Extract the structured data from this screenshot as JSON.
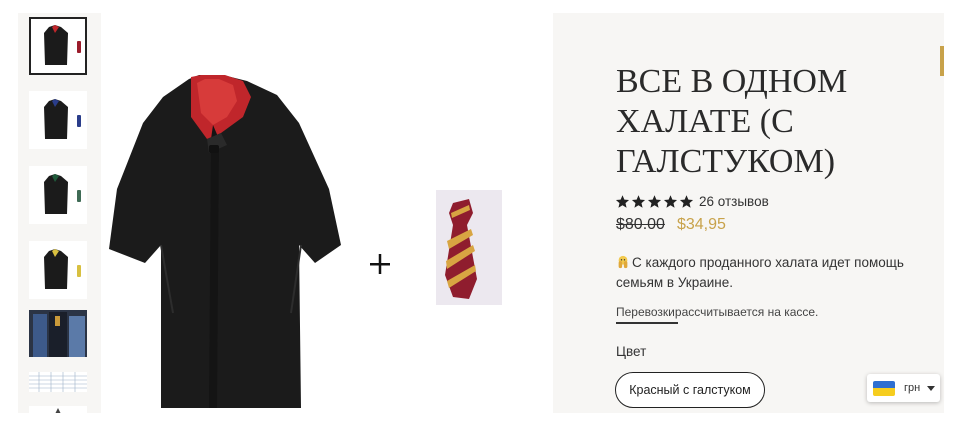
{
  "gallery": {
    "thumbnails": [
      {
        "name": "thumb-robe-red",
        "tie_color": "#9b1c2b",
        "active": true
      },
      {
        "name": "thumb-robe-blue",
        "tie_color": "#2a3d8a",
        "active": false
      },
      {
        "name": "thumb-robe-green",
        "tie_color": "#1f5a3a",
        "active": false
      },
      {
        "name": "thumb-robe-yellow",
        "tie_color": "#d8c040",
        "active": false
      },
      {
        "name": "thumb-robe-photo",
        "active": false
      },
      {
        "name": "thumb-size-chart",
        "active": false
      },
      {
        "name": "thumb-robe-model",
        "active": false
      }
    ],
    "plus_sign": "+"
  },
  "product": {
    "title": "ВСЕ В ОДНОМ ХАЛАТЕ (С ГАЛСТУКОМ)",
    "rating": 5,
    "reviews": "26 отзывов",
    "old_price": "$80.00",
    "sale_price": "$34,95",
    "charity_text": "С каждого проданного халата идет помощь семьям в Украине.",
    "shipping_link": "Перевозки",
    "shipping_text": "рассчитывается на кассе.",
    "color_label": "Цвет",
    "color_option": "Красный с галстуком"
  },
  "currency_selector": {
    "code": "грн",
    "flag": "ukraine-flag-icon"
  },
  "colors": {
    "gold": "#c8a24a",
    "robe": "#1b1b1b",
    "lining": "#c0262b",
    "panel_bg": "#f7f6f4"
  }
}
